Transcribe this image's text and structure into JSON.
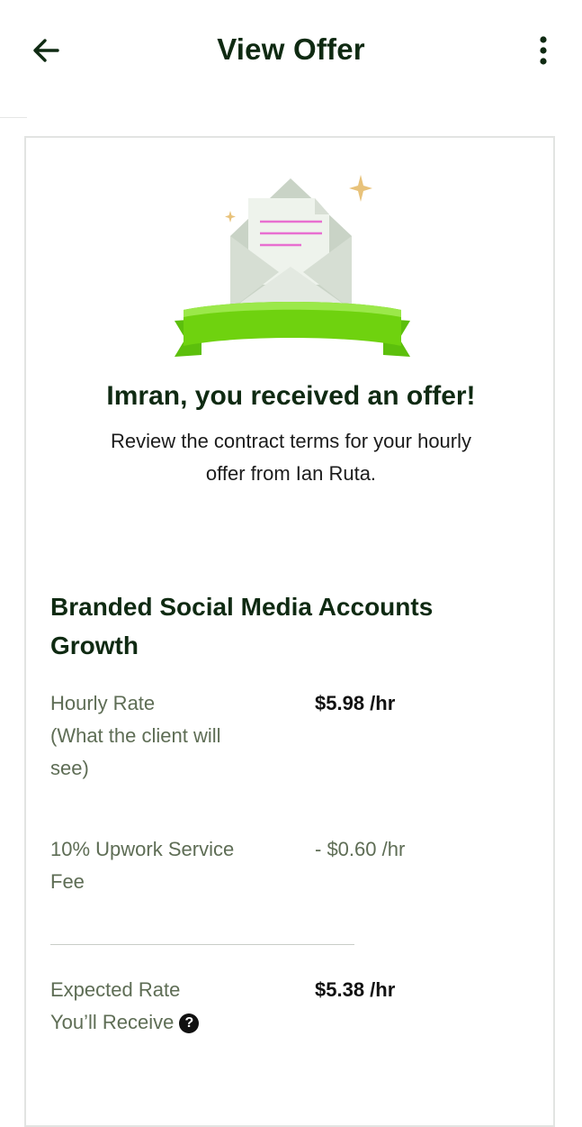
{
  "header": {
    "title": "View Offer",
    "back_icon": "arrow-left-icon",
    "menu_icon": "more-vertical-icon"
  },
  "offer": {
    "headline": "Imran, you received an offer!",
    "subtitle_line1": "Review the contract terms for your hourly",
    "subtitle_line2": "offer from Ian Ruta.",
    "illustration_icon": "envelope-ribbon-icon"
  },
  "contract": {
    "job_title_line1": "Branded Social Media Accounts",
    "job_title_line2": "Growth",
    "rows": [
      {
        "label_lines": [
          "Hourly Rate",
          "(What the client will",
          "see)"
        ],
        "value": "$5.98 /hr"
      },
      {
        "label_lines": [
          "10% Upwork Service",
          "Fee"
        ],
        "value": "- $0.60 /hr"
      },
      {
        "label_lines": [
          "Expected Rate",
          "You’ll Receive"
        ],
        "value": "$5.38 /hr",
        "help_icon": "question-circle-icon",
        "help_glyph": "?"
      }
    ]
  },
  "colors": {
    "brand_dark_green": "#0f2a12",
    "ribbon_green": "#6fd20f",
    "muted_text": "#5e6d55",
    "letter_lines": "#e86fd0",
    "sparkle": "#e8c27a"
  }
}
